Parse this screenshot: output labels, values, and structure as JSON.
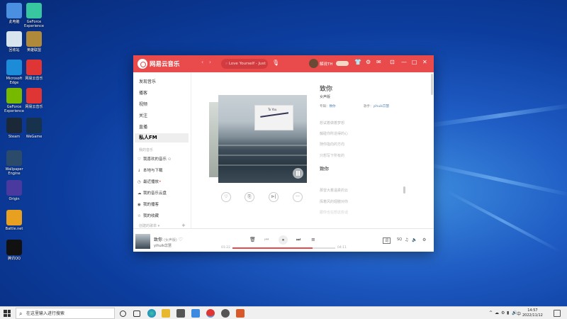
{
  "desktop": {
    "icons": [
      {
        "label": "此电脑",
        "color": "#4a8fe0"
      },
      {
        "label": "GeForce Experience",
        "color": "#38c6a0"
      },
      {
        "label": "回收站",
        "color": "#d8e4ee"
      },
      {
        "label": "英雄联盟",
        "color": "#b08a3a"
      },
      {
        "label": "Microsoft Edge",
        "color": "#1c8bd8"
      },
      {
        "label": "网易云音乐",
        "color": "#e03535"
      },
      {
        "label": "GeForce Experience",
        "color": "#76b900"
      },
      {
        "label": "网易云音乐",
        "color": "#e03535"
      },
      {
        "label": "Steam",
        "color": "#1b2838"
      },
      {
        "label": "WeGame",
        "color": "#16324c"
      },
      {
        "label": "Wallpaper Engine",
        "color": "#2c4a6a"
      },
      {
        "label": "Origin",
        "color": "#4a3aa0"
      },
      {
        "label": "Battle.net",
        "color": "#e8a020"
      },
      {
        "label": "腾讯QQ",
        "color": "#111111"
      }
    ]
  },
  "window": {
    "app_name": "网易云音乐",
    "nav_back": "‹",
    "nav_fwd": "›",
    "search_placeholder": "Love Yourself - Just",
    "mic_icon": "🎙",
    "username": "解说TH",
    "titlebar_icons": [
      "👕",
      "⚙",
      "✉",
      "⊡",
      "—",
      "□",
      "✕"
    ]
  },
  "sidebar": {
    "items": [
      "发现音乐",
      "播客",
      "视频",
      "关注",
      "直播"
    ],
    "active": "私人FM",
    "section_head": "我的音乐",
    "my_music": [
      {
        "icon": "♡",
        "label": "我喜欢的音乐"
      },
      {
        "icon": "↓",
        "label": "本地与下载"
      },
      {
        "icon": "◷",
        "label": "最近播放"
      },
      {
        "icon": "☁",
        "label": "我的音乐云盘"
      },
      {
        "icon": "◉",
        "label": "我的播客"
      },
      {
        "icon": "☆",
        "label": "我的收藏"
      }
    ],
    "playlist_head": "创建的歌单 ▾",
    "playlist_add": "+"
  },
  "fm": {
    "album_card_text": "To You",
    "song_title": "致你",
    "song_sub": "女声版",
    "album_label": "专辑：",
    "album_value": "致你",
    "artist_label": "歌手：",
    "artist_value": "yihuik苡慧",
    "lyrics_before": [
      "想试着做着梦想",
      "触碰你所造得的心",
      "随你指向的方向",
      "只想写下所有的"
    ],
    "lyric_current": "致你",
    "lyrics_after": [
      "那曾大着温柔的云",
      "挥着风的翅膀对你",
      "跟你也在想这些话"
    ],
    "actions": [
      "♡",
      "⎘",
      "⊳|",
      "···"
    ]
  },
  "player": {
    "title": "致你",
    "subtitle": "(女声版)",
    "artist": "yihuik苡慧",
    "time_current": "01:22",
    "time_total": "04:11",
    "progress": 0.78,
    "controls": [
      "🗑",
      "⏮",
      "⏸",
      "⏭",
      "≡"
    ],
    "right_icons": [
      "词",
      "SQ",
      "♫",
      "🔈",
      "⚙"
    ]
  },
  "taskbar": {
    "search_placeholder": "在这里输入进行搜索",
    "tray_icons": [
      "^",
      "☁",
      "⚙",
      "▮",
      "🔊",
      "中"
    ],
    "time": "14:57",
    "date": "2022/11/12"
  }
}
